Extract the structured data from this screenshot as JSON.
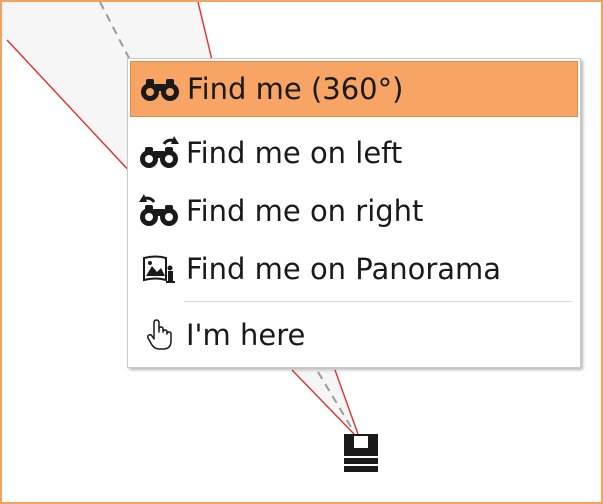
{
  "colors": {
    "accent": "#f7a465",
    "border": "#f3a35f",
    "line": "#e03030"
  },
  "menu": {
    "items": [
      {
        "label": "Find me (360°)",
        "icon": "binoculars-icon",
        "active": true
      },
      {
        "label": "Find me on left",
        "icon": "binoculars-left-icon",
        "active": false
      },
      {
        "label": "Find me on right",
        "icon": "binoculars-right-icon",
        "active": false
      },
      {
        "label": "Find me on Panorama",
        "icon": "panorama-icon",
        "active": false
      },
      {
        "label": "I'm here",
        "icon": "hand-pointer-icon",
        "active": false
      }
    ]
  }
}
